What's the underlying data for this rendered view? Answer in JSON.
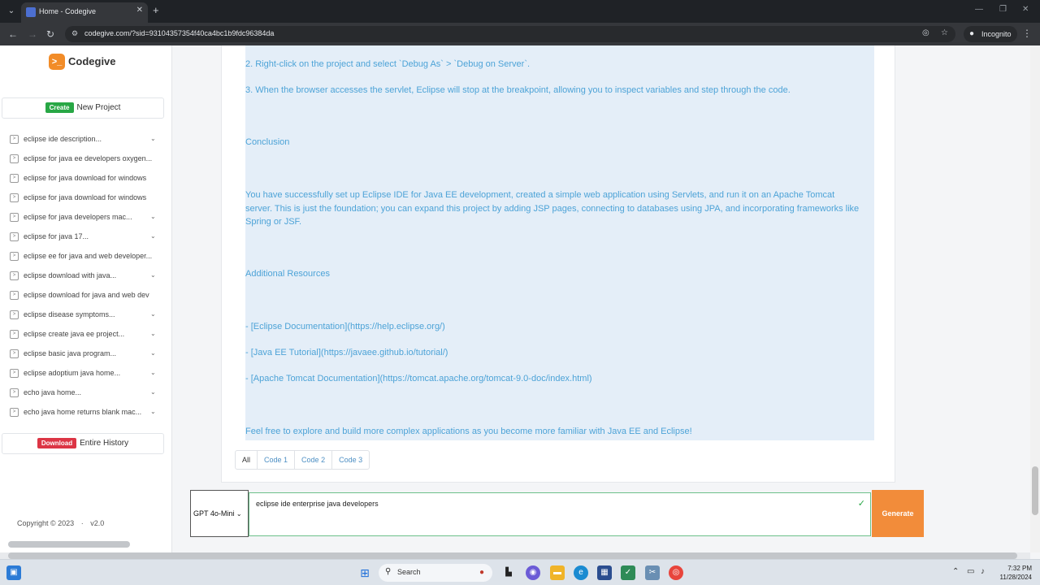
{
  "browser": {
    "tab_title": "Home - Codegive",
    "url": "codegive.com/?sid=93104357354f40ca4bc1b9fdc96384da",
    "incognito_label": "Incognito"
  },
  "sidebar": {
    "brand": "Codegive",
    "create_badge": "Create",
    "create_label": "New Project",
    "history": [
      {
        "label": "eclipse ide description...",
        "chevron": "⌄"
      },
      {
        "label": "eclipse for java ee developers oxygen...",
        "chevron": ""
      },
      {
        "label": "eclipse for java download for windows",
        "chevron": ""
      },
      {
        "label": "eclipse for java download for windows",
        "chevron": ""
      },
      {
        "label": "eclipse for java developers mac...",
        "chevron": "⌄"
      },
      {
        "label": "eclipse for java 17...",
        "chevron": "⌄"
      },
      {
        "label": "eclipse ee for java and web developer...",
        "chevron": ""
      },
      {
        "label": "eclipse download with java...",
        "chevron": "⌄"
      },
      {
        "label": "eclipse download for java and web dev",
        "chevron": ""
      },
      {
        "label": "eclipse disease symptoms...",
        "chevron": "⌄"
      },
      {
        "label": "eclipse create java ee project...",
        "chevron": "⌄"
      },
      {
        "label": "eclipse basic java program...",
        "chevron": "⌄"
      },
      {
        "label": "eclipse adoptium java home...",
        "chevron": "⌄"
      },
      {
        "label": "echo java home...",
        "chevron": "⌄"
      },
      {
        "label": "echo java home returns blank mac...",
        "chevron": "⌄"
      }
    ],
    "download_badge": "Download",
    "download_label": "Entire History",
    "copyright": "Copyright © 2023",
    "version": "v2.0"
  },
  "content": {
    "paragraphs": [
      "2. Right-click on the project and select `Debug As` > `Debug on Server`.",
      "3. When the browser accesses the servlet, Eclipse will stop at the breakpoint, allowing you to inspect variables and step through the code.",
      "Conclusion",
      "You have successfully set up Eclipse IDE for Java EE development, created a simple web application using Servlets, and run it on an Apache Tomcat server. This is just the foundation; you can expand this project by adding JSP pages, connecting to databases using JPA, and incorporating frameworks like Spring or JSF.",
      "Additional Resources",
      "- [Eclipse Documentation](https://help.eclipse.org/)",
      "- [Java EE Tutorial](https://javaee.github.io/tutorial/)",
      "- [Apache Tomcat Documentation](https://tomcat.apache.org/tomcat-9.0-doc/index.html)",
      "Feel free to explore and build more complex applications as you become more familiar with Java EE and Eclipse!"
    ],
    "tabs": [
      "All",
      "Code 1",
      "Code 2",
      "Code 3"
    ]
  },
  "prompt": {
    "model": "GPT 4o-Mini",
    "text": "eclipse ide enterprise java developers",
    "generate_label": "Generate"
  },
  "taskbar": {
    "search_label": "Search",
    "time": "7:32 PM",
    "date": "11/28/2024"
  },
  "colors": {
    "accent": "#f28c3a",
    "answer_text": "#4da3d7",
    "answer_bg": "#e4eef8",
    "create_badge": "#28a745",
    "download_badge": "#dc3545"
  }
}
